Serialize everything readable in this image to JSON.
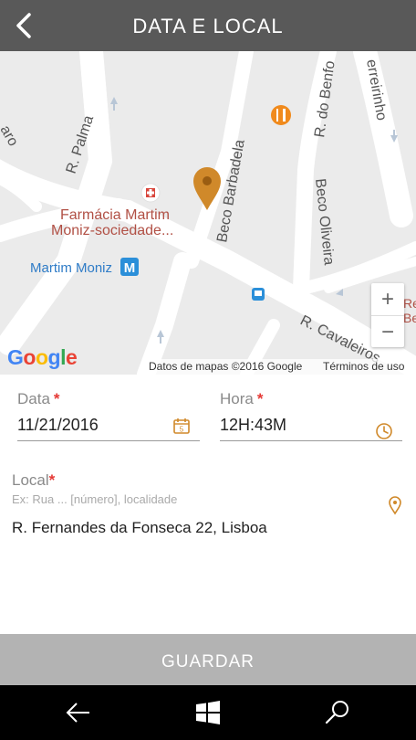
{
  "header": {
    "title": "DATA E LOCAL"
  },
  "map": {
    "streets": [
      "R. Palma",
      "Beco Barbadela",
      "R. do Benfo",
      "erreirinho",
      "Beco Oliveira",
      "R. Cavaleiros",
      "aro"
    ],
    "places": [
      "Farmácia Martim",
      "Moniz-sociedade...",
      "Martim Moniz"
    ],
    "edge_labels": [
      "Re",
      "Be"
    ],
    "attribution": "Datos de mapas ©2016 Google",
    "terms": "Términos de uso",
    "google_logo": "Google",
    "zoom_in": "+",
    "zoom_out": "−"
  },
  "form": {
    "date_label": "Data",
    "date_value": "11/21/2016",
    "time_label": "Hora",
    "time_value": "12H:43M",
    "required_marker": "*",
    "location_label": "Local",
    "location_placeholder": "Ex: Rua ... [número], localidade",
    "location_value": "R. Fernandes da Fonseca 22, Lisboa",
    "calendar_day": "5"
  },
  "save_label": "GUARDAR",
  "colors": {
    "accent": "#d0892a",
    "header": "#595959",
    "required": "#e53935",
    "save": "#b3b3b3"
  },
  "icons": [
    "back-arrow-icon",
    "map-pin-icon",
    "calendar-icon",
    "clock-icon",
    "location-pin-icon",
    "windows-icon",
    "search-icon"
  ]
}
